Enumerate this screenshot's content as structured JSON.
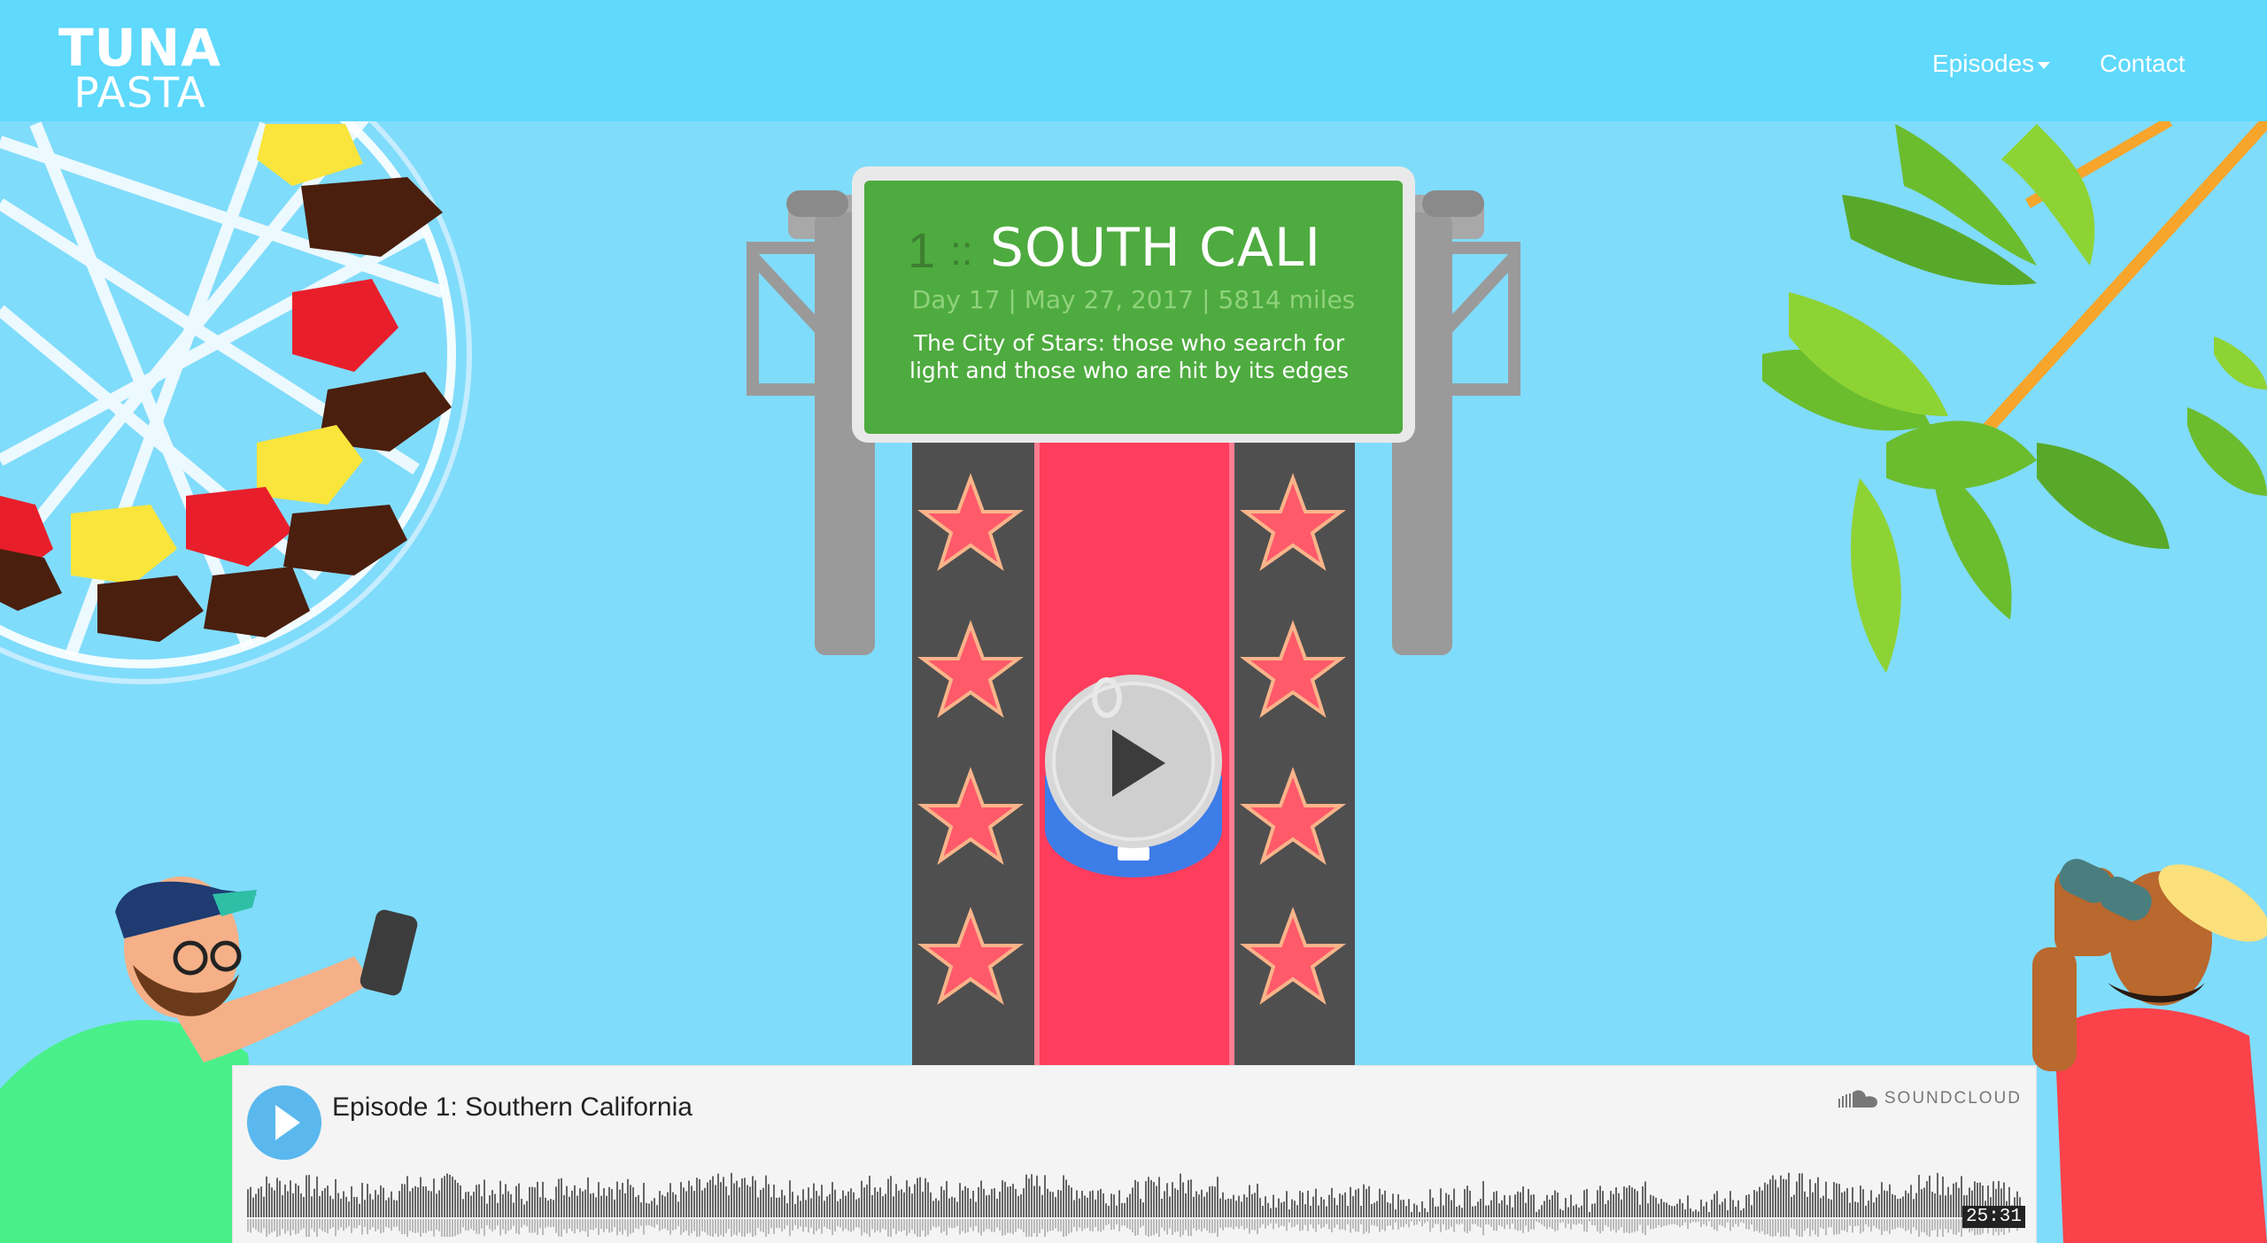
{
  "nav": {
    "logo_line1": "TUNA",
    "logo_line2": "PASTA",
    "episodes_label": "Episodes",
    "contact_label": "Contact"
  },
  "episode": {
    "number": "1",
    "separator": "::",
    "title": "SOUTH CALI",
    "meta": "Day 17 | May 27, 2017 | 5814 miles",
    "description": "The City of Stars: those who search for light and those who are hit by its edges"
  },
  "player": {
    "track_title": "Episode 1: Southern California",
    "brand": "SOUNDCLOUD",
    "duration": "25:31",
    "played_fraction": 0
  },
  "icons": {
    "play": "play-icon",
    "caret": "caret-down-icon",
    "cloud": "soundcloud-icon"
  },
  "colors": {
    "nav_bg": "#5fd9fc",
    "sky": "#80dcfb",
    "sign_green": "#4eab3f",
    "carpet_red": "#ff3d5c",
    "player_blue": "#5ab8ee"
  }
}
